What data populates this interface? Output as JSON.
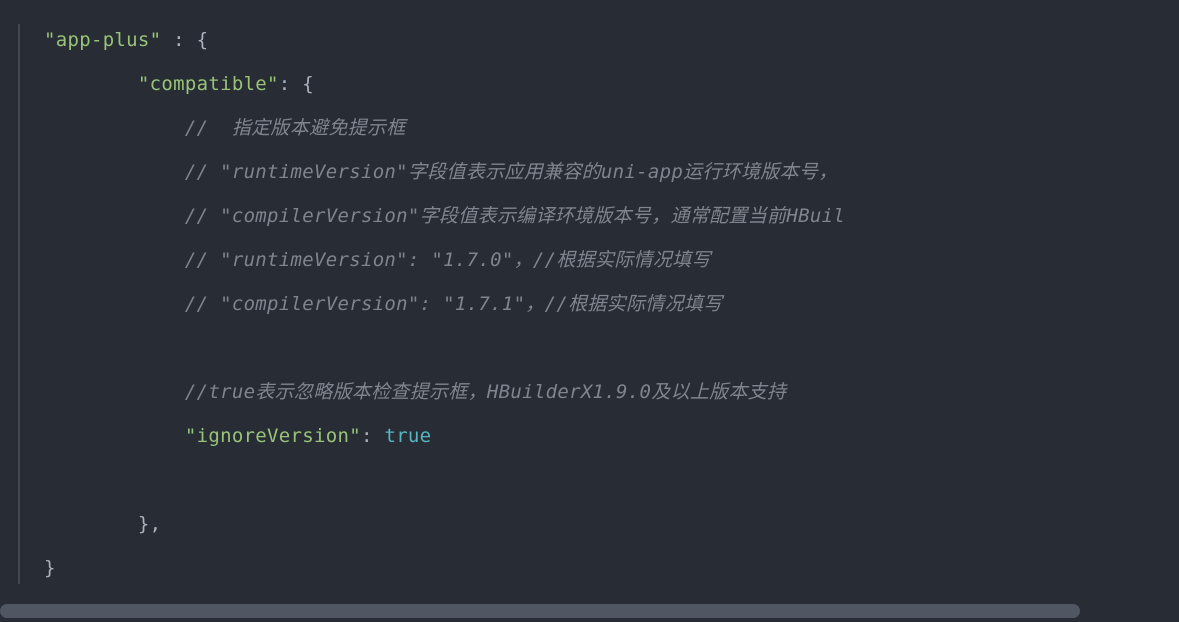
{
  "code": {
    "line1": {
      "key": "\"app-plus\"",
      "sep": " : ",
      "brace": "{"
    },
    "line2": {
      "indent": "        ",
      "key": "\"compatible\"",
      "sep": ": ",
      "brace": "{"
    },
    "line3": {
      "indent": "            ",
      "comment": "//  指定版本避免提示框"
    },
    "line4": {
      "indent": "            ",
      "comment": "// \"runtimeVersion\"字段值表示应用兼容的uni-app运行环境版本号，"
    },
    "line5": {
      "indent": "            ",
      "comment": "// \"compilerVersion\"字段值表示编译环境版本号，通常配置当前HBuil"
    },
    "line6": {
      "indent": "            ",
      "comment": "// \"runtimeVersion\": \"1.7.0\"，//根据实际情况填写"
    },
    "line7": {
      "indent": "            ",
      "comment": "// \"compilerVersion\": \"1.7.1\"，//根据实际情况填写"
    },
    "line8": {
      "indent": "            ",
      "comment": ""
    },
    "line9": {
      "indent": "            ",
      "comment": "//true表示忽略版本检查提示框，HBuilderX1.9.0及以上版本支持"
    },
    "line10": {
      "indent": "            ",
      "key": "\"ignoreVersion\"",
      "sep": ": ",
      "value": "true"
    },
    "line11": {
      "indent": "            ",
      "text": ""
    },
    "line12": {
      "indent": "        ",
      "brace": "},"
    },
    "line13": {
      "brace": "}"
    }
  }
}
